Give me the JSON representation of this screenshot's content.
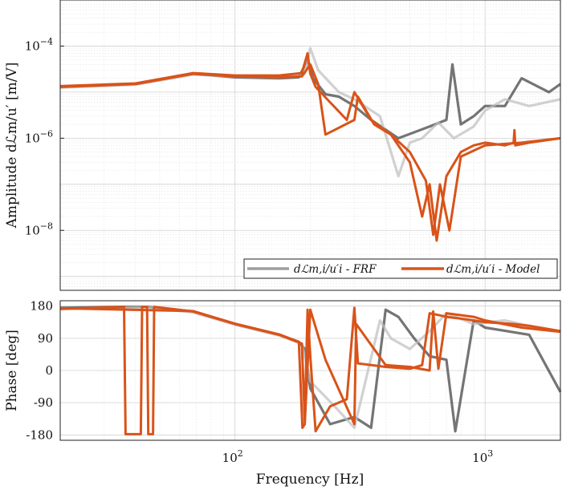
{
  "chart_data": [
    {
      "type": "line",
      "panel": "amplitude",
      "xscale": "log",
      "yscale": "log",
      "xlim": [
        20,
        2000
      ],
      "ylim": [
        5e-10,
        0.001
      ],
      "ylabel": "Amplitude dℒm/u′ [m/V]",
      "yticks": [
        {
          "value": 0.0001,
          "base": "10",
          "exp": "−4"
        },
        {
          "value": 1e-06,
          "base": "10",
          "exp": "−6"
        },
        {
          "value": 1e-08,
          "base": "10",
          "exp": "−8"
        }
      ],
      "grid": true,
      "legend": {
        "placement": "bottom-right",
        "entries": [
          {
            "label": "dℒm,i/u′i - FRF",
            "color": "#9e9e9e"
          },
          {
            "label": "dℒm,i/u′i - Model",
            "color": "#d95319"
          }
        ]
      },
      "series": [
        {
          "role": "frf",
          "color": "#3a3a3a",
          "x": [
            20,
            40,
            68,
            100,
            150,
            180,
            195,
            205,
            230,
            260,
            300,
            350,
            450,
            600,
            700,
            740,
            800,
            900,
            1000,
            1200,
            1400,
            1800,
            2000
          ],
          "y": [
            1.3e-05,
            1.5e-05,
            2.5e-05,
            2.1e-05,
            2e-05,
            2.1e-05,
            5e-05,
            2e-05,
            9e-06,
            8e-06,
            5e-06,
            2.5e-06,
            1e-06,
            1.8e-06,
            2.5e-06,
            4e-05,
            2e-06,
            3e-06,
            5e-06,
            5e-06,
            2e-05,
            1e-05,
            1.5e-05
          ]
        },
        {
          "role": "frf",
          "color": "#bdbdbd",
          "x": [
            20,
            40,
            68,
            100,
            150,
            190,
            200,
            215,
            260,
            300,
            380,
            450,
            500,
            560,
            650,
            750,
            900,
            1000,
            1200,
            1500,
            2000
          ],
          "y": [
            1.25e-05,
            1.45e-05,
            2.4e-05,
            2.2e-05,
            2.1e-05,
            2.5e-05,
            9e-05,
            3e-05,
            1e-05,
            7e-06,
            3e-06,
            1.5e-07,
            8e-07,
            1e-06,
            2.2e-06,
            1e-06,
            1.8e-06,
            4e-06,
            7e-06,
            5e-06,
            7e-06
          ]
        },
        {
          "role": "model",
          "color": "#d95319",
          "x": [
            20,
            40,
            68,
            100,
            150,
            185,
            195,
            200,
            210,
            240,
            280,
            300,
            350,
            420,
            500,
            560,
            600,
            640,
            700,
            800,
            900,
            1000,
            1200,
            1300,
            1310,
            1320,
            1500,
            2000
          ],
          "y": [
            1.35e-05,
            1.55e-05,
            2.6e-05,
            2.3e-05,
            2.3e-05,
            2.6e-05,
            7e-05,
            2.5e-05,
            1.3e-05,
            6e-06,
            2.5e-06,
            1e-05,
            2.5e-06,
            1.2e-06,
            3e-07,
            2e-08,
            1e-07,
            6e-09,
            1.5e-07,
            5e-07,
            7e-07,
            8e-07,
            7e-07,
            8e-07,
            1.5e-06,
            7e-07,
            8e-07,
            1e-06
          ]
        },
        {
          "role": "model",
          "color": "#d95319",
          "x": [
            20,
            40,
            68,
            100,
            150,
            185,
            200,
            215,
            230,
            300,
            310,
            360,
            420,
            500,
            580,
            620,
            660,
            720,
            800,
            1000,
            1400,
            2000
          ],
          "y": [
            1.3e-05,
            1.5e-05,
            2.5e-05,
            2.2e-05,
            2.1e-05,
            2.2e-05,
            4e-05,
            1.5e-05,
            1.2e-06,
            2.5e-06,
            8e-06,
            2e-06,
            1.2e-06,
            5e-07,
            1.2e-07,
            8e-09,
            1e-07,
            1e-08,
            4e-07,
            7e-07,
            8e-07,
            1e-06
          ]
        }
      ]
    },
    {
      "type": "line",
      "panel": "phase",
      "xscale": "log",
      "xlim": [
        20,
        2000
      ],
      "ylim": [
        -195,
        195
      ],
      "xlabel": "Frequency [Hz]",
      "ylabel": "Phase [deg]",
      "yticks": [
        180,
        90,
        0,
        -90,
        -180
      ],
      "ytick_labels": [
        "180",
        "90",
        "0",
        "-90",
        "-180"
      ],
      "xticks": [
        {
          "value": 100,
          "base": "10",
          "exp": "2"
        },
        {
          "value": 1000,
          "base": "10",
          "exp": "3"
        }
      ],
      "grid": true,
      "series": [
        {
          "role": "frf",
          "color": "#3a3a3a",
          "x": [
            20,
            35,
            45,
            68,
            100,
            150,
            180,
            190,
            200,
            240,
            300,
            350,
            400,
            450,
            520,
            600,
            700,
            760,
            900,
            1000,
            1500,
            2000
          ],
          "y": [
            175,
            178,
            178,
            165,
            130,
            100,
            80,
            60,
            -50,
            -150,
            -130,
            -160,
            170,
            150,
            90,
            40,
            30,
            -170,
            140,
            120,
            100,
            -60
          ]
        },
        {
          "role": "frf",
          "color": "#bdbdbd",
          "x": [
            20,
            35,
            45,
            68,
            100,
            150,
            185,
            200,
            250,
            300,
            380,
            420,
            500,
            600,
            700,
            900,
            1200,
            1600,
            2000
          ],
          "y": [
            172,
            176,
            177,
            162,
            128,
            98,
            75,
            -30,
            -100,
            -160,
            140,
            90,
            60,
            110,
            160,
            130,
            140,
            120,
            110
          ]
        },
        {
          "role": "model",
          "color": "#d95319",
          "x": [
            20,
            36,
            36.5,
            42,
            42.5,
            44.5,
            45,
            47,
            47.5,
            68,
            100,
            150,
            185,
            190,
            195,
            200,
            210,
            240,
            280,
            300,
            310,
            400,
            500,
            560,
            600,
            650,
            700,
            800,
            900,
            1000,
            1300,
            1500,
            2000
          ],
          "y": [
            172,
            178,
            -178,
            -178,
            178,
            178,
            -178,
            -178,
            178,
            165,
            130,
            100,
            75,
            -140,
            170,
            40,
            -170,
            -100,
            -80,
            175,
            20,
            10,
            5,
            15,
            160,
            155,
            150,
            145,
            140,
            135,
            130,
            125,
            110
          ]
        },
        {
          "role": "model",
          "color": "#d95319",
          "x": [
            20,
            68,
            100,
            150,
            180,
            186,
            190,
            200,
            230,
            300,
            305,
            400,
            500,
            600,
            620,
            650,
            700,
            900,
            1000,
            1400,
            2000
          ],
          "y": [
            174,
            166,
            131,
            101,
            80,
            -160,
            -150,
            170,
            30,
            -150,
            130,
            15,
            10,
            0,
            165,
            5,
            160,
            150,
            140,
            120,
            108
          ]
        }
      ]
    }
  ]
}
